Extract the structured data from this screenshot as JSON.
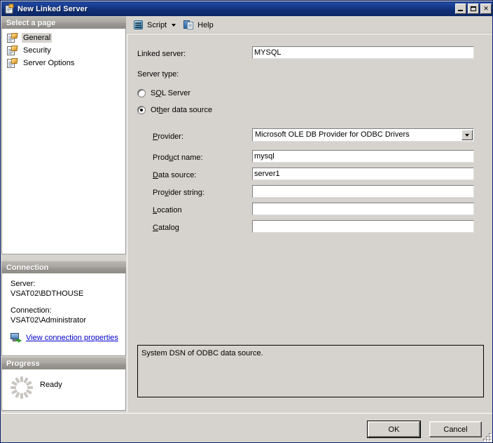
{
  "window": {
    "title": "New Linked Server",
    "title_icon": "linked-server-icon",
    "minimize_label": "Minimize",
    "maximize_label": "Maximize",
    "close_label": "Close"
  },
  "sidebar": {
    "pages_header": "Select a page",
    "items": [
      {
        "label": "General",
        "icon": "page-icon",
        "selected": true
      },
      {
        "label": "Security",
        "icon": "page-icon",
        "selected": false
      },
      {
        "label": "Server Options",
        "icon": "page-icon",
        "selected": false
      }
    ],
    "connection": {
      "header": "Connection",
      "server_label": "Server:",
      "server_value": "VSAT02\\BDTHOUSE",
      "connection_label": "Connection:",
      "connection_value": "VSAT02\\Administrator",
      "link_text": "View connection properties",
      "link_icon": "connection-properties-icon"
    },
    "progress": {
      "header": "Progress",
      "status": "Ready",
      "spinner_icon": "progress-spinner-icon"
    }
  },
  "toolbar": {
    "script_label": "Script",
    "script_icon": "script-icon",
    "dropdown_icon": "chevron-down-icon",
    "help_label": "Help",
    "help_icon": "help-icon"
  },
  "form": {
    "linked_server_label": "Linked server:",
    "linked_server_value": "MYSQL",
    "server_type_label": "Server type:",
    "radio_sql_server": "SQL Server",
    "radio_other_source": "Other data source",
    "selected_server_type": "Other data source",
    "provider_label": "Provider:",
    "provider_value": "Microsoft OLE DB Provider for ODBC Drivers",
    "product_name_label": "Product name:",
    "product_name_value": "mysql",
    "data_source_label": "Data source:",
    "data_source_value": "server1",
    "provider_string_label": "Provider string:",
    "provider_string_value": "",
    "location_label": "Location",
    "location_value": "",
    "catalog_label": "Catalog",
    "catalog_value": "",
    "description": "System DSN of ODBC data source."
  },
  "footer": {
    "ok_label": "OK",
    "cancel_label": "Cancel"
  },
  "colors": {
    "title_bar": "#11307a",
    "dialog_face": "#d6d3ce",
    "link": "#0000cc",
    "panel_header": "#9d9a95"
  }
}
